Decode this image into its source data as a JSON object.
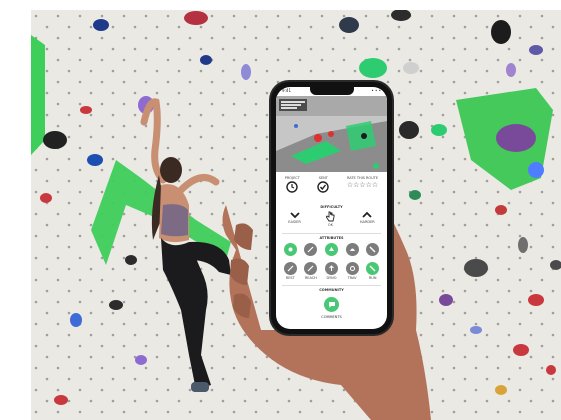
{
  "phone": {
    "status_time": "9:41",
    "status_carrier": "• • •",
    "route_info_line1": "",
    "project_label": "PROJECT",
    "sent_label": "SENT",
    "rate_label": "RATE THIS ROUTE",
    "difficulty_title": "DIFFICULTY",
    "harder_label": "EASIER",
    "ok_label": "OK",
    "easier_label": "HARDER",
    "attributes_title": "ATTRIBUTES",
    "attributes": [
      {
        "label": "",
        "state": "on",
        "icon": "hand-icon"
      },
      {
        "label": "",
        "state": "off",
        "icon": "pinch-icon"
      },
      {
        "label": "",
        "state": "on",
        "icon": "crimp-icon"
      },
      {
        "label": "",
        "state": "off",
        "icon": "sloper-icon"
      },
      {
        "label": "",
        "state": "off",
        "icon": "slash-icon"
      },
      {
        "label": "REST",
        "state": "off",
        "icon": "rest-icon"
      },
      {
        "label": "REACH",
        "state": "off",
        "icon": "reach-icon"
      },
      {
        "label": "DYNO",
        "state": "off",
        "icon": "dyno-icon"
      },
      {
        "label": "TRAV",
        "state": "off",
        "icon": "traverse-icon"
      },
      {
        "label": "RUN",
        "state": "on",
        "icon": "run-icon"
      }
    ],
    "community_title": "COMMUNITY",
    "comments_label": "COMMENTS"
  },
  "colors": {
    "accent_green": "#48c774",
    "hold_green": "#3ecf5a",
    "wall": "#e9e7e2"
  }
}
